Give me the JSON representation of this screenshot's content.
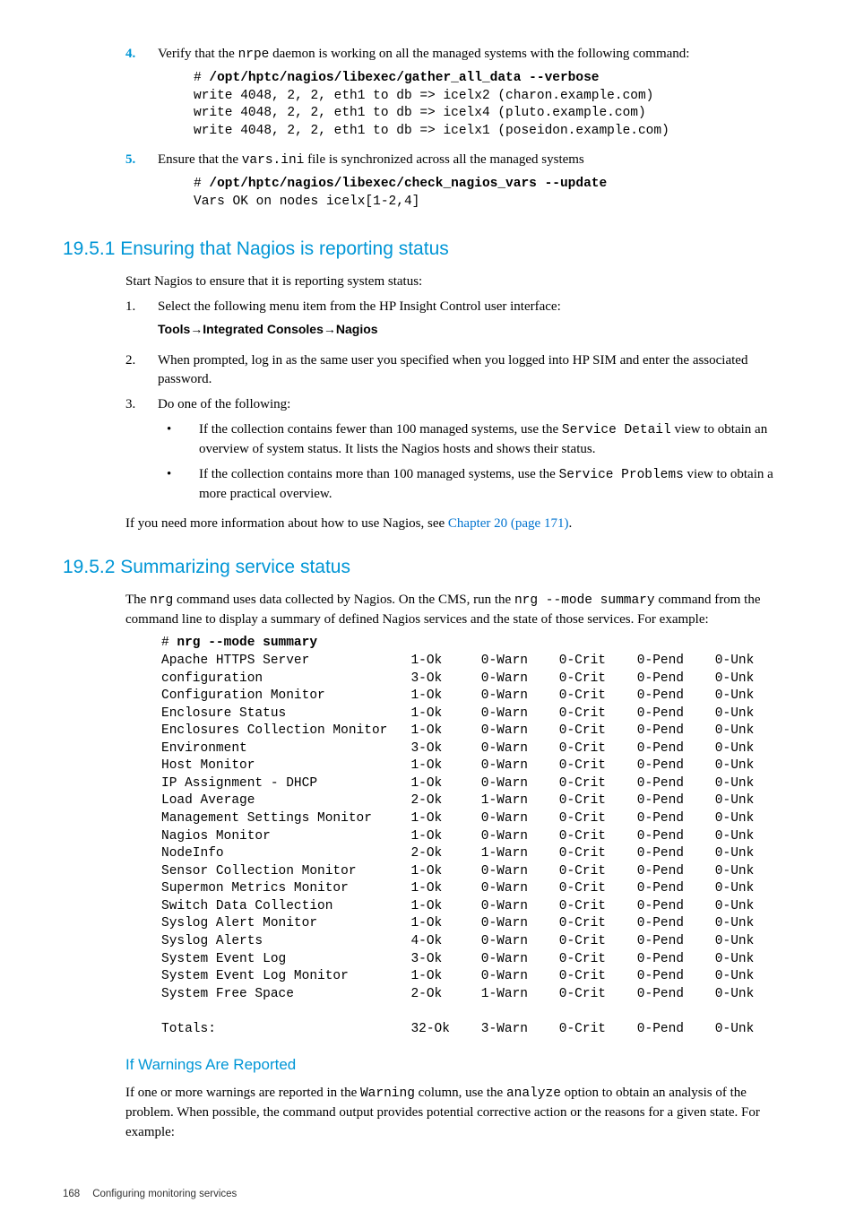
{
  "step4": {
    "num": "4.",
    "text_a": "Verify that the ",
    "code_a": "nrpe",
    "text_b": " daemon is working on all the managed systems with the following command:",
    "cmd_lead": "# ",
    "cmd": "/opt/hptc/nagios/libexec/gather_all_data --verbose",
    "out1": "write 4048, 2, 2, eth1 to db => icelx2 (charon.example.com)",
    "out2": "write 4048, 2, 2, eth1 to db => icelx4 (pluto.example.com)",
    "out3": "write 4048, 2, 2, eth1 to db => icelx1 (poseidon.example.com)"
  },
  "step5": {
    "num": "5.",
    "text_a": "Ensure that the ",
    "code_a": "vars.ini",
    "text_b": " file is synchronized across all the managed systems",
    "cmd_lead": "# ",
    "cmd": "/opt/hptc/nagios/libexec/check_nagios_vars --update",
    "out1": "Vars OK on nodes icelx[1-2,4]"
  },
  "sec1951": {
    "title": "19.5.1 Ensuring that Nagios is reporting status",
    "intro": "Start Nagios to ensure that it is reporting system status:",
    "s1": {
      "num": "1.",
      "text": "Select the following menu item from the HP Insight Control user interface:",
      "menu": "Tools→Integrated Consoles→Nagios"
    },
    "s2": {
      "num": "2.",
      "text": "When prompted, log in as the same user you specified when you logged into HP SIM and enter the associated password."
    },
    "s3": {
      "num": "3.",
      "text": "Do one of the following:",
      "b1a": "If the collection contains fewer than 100 managed systems, use the ",
      "b1code": "Service Detail",
      "b1b": " view to obtain an overview of system status. It lists the Nagios hosts and shows their status.",
      "b2a": "If the collection contains more than 100 managed systems, use the ",
      "b2code": "Service Problems",
      "b2b": " view to obtain a more practical overview."
    },
    "outro_a": "If you need more information about how to use Nagios, see ",
    "outro_link": "Chapter 20 (page 171)",
    "outro_b": "."
  },
  "sec1952": {
    "title": "19.5.2 Summarizing service status",
    "p1a": "The ",
    "p1code1": "nrg",
    "p1b": " command uses data collected by Nagios. On the CMS, run the ",
    "p1code2": "nrg --mode summary",
    "p1c": " command from the command line to display a summary of defined Nagios services and the state of those services. For example:",
    "cmd_lead": "# ",
    "cmd": "nrg --mode summary",
    "rows": [
      [
        "Apache HTTPS Server",
        "1-Ok",
        "0-Warn",
        "0-Crit",
        "0-Pend",
        "0-Unk"
      ],
      [
        "configuration",
        "3-Ok",
        "0-Warn",
        "0-Crit",
        "0-Pend",
        "0-Unk"
      ],
      [
        "Configuration Monitor",
        "1-Ok",
        "0-Warn",
        "0-Crit",
        "0-Pend",
        "0-Unk"
      ],
      [
        "Enclosure Status",
        "1-Ok",
        "0-Warn",
        "0-Crit",
        "0-Pend",
        "0-Unk"
      ],
      [
        "Enclosures Collection Monitor",
        "1-Ok",
        "0-Warn",
        "0-Crit",
        "0-Pend",
        "0-Unk"
      ],
      [
        "Environment",
        "3-Ok",
        "0-Warn",
        "0-Crit",
        "0-Pend",
        "0-Unk"
      ],
      [
        "Host Monitor",
        "1-Ok",
        "0-Warn",
        "0-Crit",
        "0-Pend",
        "0-Unk"
      ],
      [
        "IP Assignment - DHCP",
        "1-Ok",
        "0-Warn",
        "0-Crit",
        "0-Pend",
        "0-Unk"
      ],
      [
        "Load Average",
        "2-Ok",
        "1-Warn",
        "0-Crit",
        "0-Pend",
        "0-Unk"
      ],
      [
        "Management Settings Monitor",
        "1-Ok",
        "0-Warn",
        "0-Crit",
        "0-Pend",
        "0-Unk"
      ],
      [
        "Nagios Monitor",
        "1-Ok",
        "0-Warn",
        "0-Crit",
        "0-Pend",
        "0-Unk"
      ],
      [
        "NodeInfo",
        "2-Ok",
        "1-Warn",
        "0-Crit",
        "0-Pend",
        "0-Unk"
      ],
      [
        "Sensor Collection Monitor",
        "1-Ok",
        "0-Warn",
        "0-Crit",
        "0-Pend",
        "0-Unk"
      ],
      [
        "Supermon Metrics Monitor",
        "1-Ok",
        "0-Warn",
        "0-Crit",
        "0-Pend",
        "0-Unk"
      ],
      [
        "Switch Data Collection",
        "1-Ok",
        "0-Warn",
        "0-Crit",
        "0-Pend",
        "0-Unk"
      ],
      [
        "Syslog Alert Monitor",
        "1-Ok",
        "0-Warn",
        "0-Crit",
        "0-Pend",
        "0-Unk"
      ],
      [
        "Syslog Alerts",
        "4-Ok",
        "0-Warn",
        "0-Crit",
        "0-Pend",
        "0-Unk"
      ],
      [
        "System Event Log",
        "3-Ok",
        "0-Warn",
        "0-Crit",
        "0-Pend",
        "0-Unk"
      ],
      [
        "System Event Log Monitor",
        "1-Ok",
        "0-Warn",
        "0-Crit",
        "0-Pend",
        "0-Unk"
      ],
      [
        "System Free Space",
        "2-Ok",
        "1-Warn",
        "0-Crit",
        "0-Pend",
        "0-Unk"
      ]
    ],
    "totals": [
      "Totals:",
      "32-Ok",
      "3-Warn",
      "0-Crit",
      "0-Pend",
      "0-Unk"
    ],
    "warnhdr": "If Warnings Are Reported",
    "warn_a": "If one or more warnings are reported in the ",
    "warn_code1": "Warning",
    "warn_b": " column, use the ",
    "warn_code2": "analyze",
    "warn_c": " option to obtain an analysis of the problem. When possible, the command output provides potential corrective action or the reasons for a given state. For example:"
  },
  "footer": {
    "page": "168",
    "title": "Configuring monitoring services"
  }
}
